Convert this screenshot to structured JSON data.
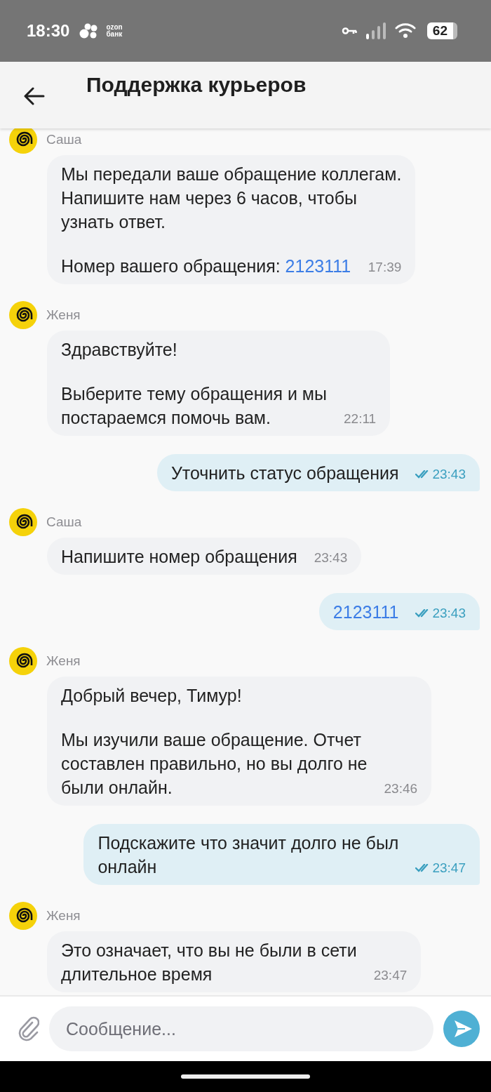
{
  "status_bar": {
    "time": "18:30",
    "app_label": [
      "ozon",
      "банк"
    ],
    "battery": "62"
  },
  "header": {
    "title": "Поддержка курьеров"
  },
  "messages": [
    {
      "kind": "incoming",
      "sender": "Саша",
      "paragraphs": [
        {
          "text": "Мы передали ваше обращение коллегам.\nНапишите нам через 6 часов, чтобы\nузнать ответ."
        },
        {
          "text": "Номер вашего обращения: ",
          "link": "2123111"
        }
      ],
      "time": "17:39"
    },
    {
      "kind": "incoming",
      "sender": "Женя",
      "paragraphs": [
        {
          "text": "Здравствуйте!"
        },
        {
          "text": "Выберите тему обращения и мы\nпостараемся помочь вам."
        }
      ],
      "time": "22:11"
    },
    {
      "kind": "outgoing",
      "paragraphs": [
        {
          "text": "Уточнить статус обращения"
        }
      ],
      "time": "23:43",
      "read": true
    },
    {
      "kind": "incoming",
      "sender": "Саша",
      "paragraphs": [
        {
          "text": "Напишите номер обращения"
        }
      ],
      "time": "23:43"
    },
    {
      "kind": "outgoing",
      "paragraphs": [
        {
          "link": "2123111"
        }
      ],
      "time": "23:43",
      "read": true
    },
    {
      "kind": "incoming",
      "sender": "Женя",
      "paragraphs": [
        {
          "text": "Добрый вечер, Тимур!"
        },
        {
          "text": "Мы изучили ваше обращение. Отчет\nсоставлен правильно, но вы долго не\nбыли онлайн."
        }
      ],
      "time": "23:46"
    },
    {
      "kind": "outgoing",
      "paragraphs": [
        {
          "text": "Подскажите что значит долго не был\nонлайн"
        }
      ],
      "time": "23:47",
      "read": true
    },
    {
      "kind": "incoming",
      "sender": "Женя",
      "paragraphs": [
        {
          "text": "Это означает, что вы не были в сети\nдлительное время"
        }
      ],
      "time": "23:47"
    }
  ],
  "composer": {
    "placeholder": "Сообщение..."
  }
}
